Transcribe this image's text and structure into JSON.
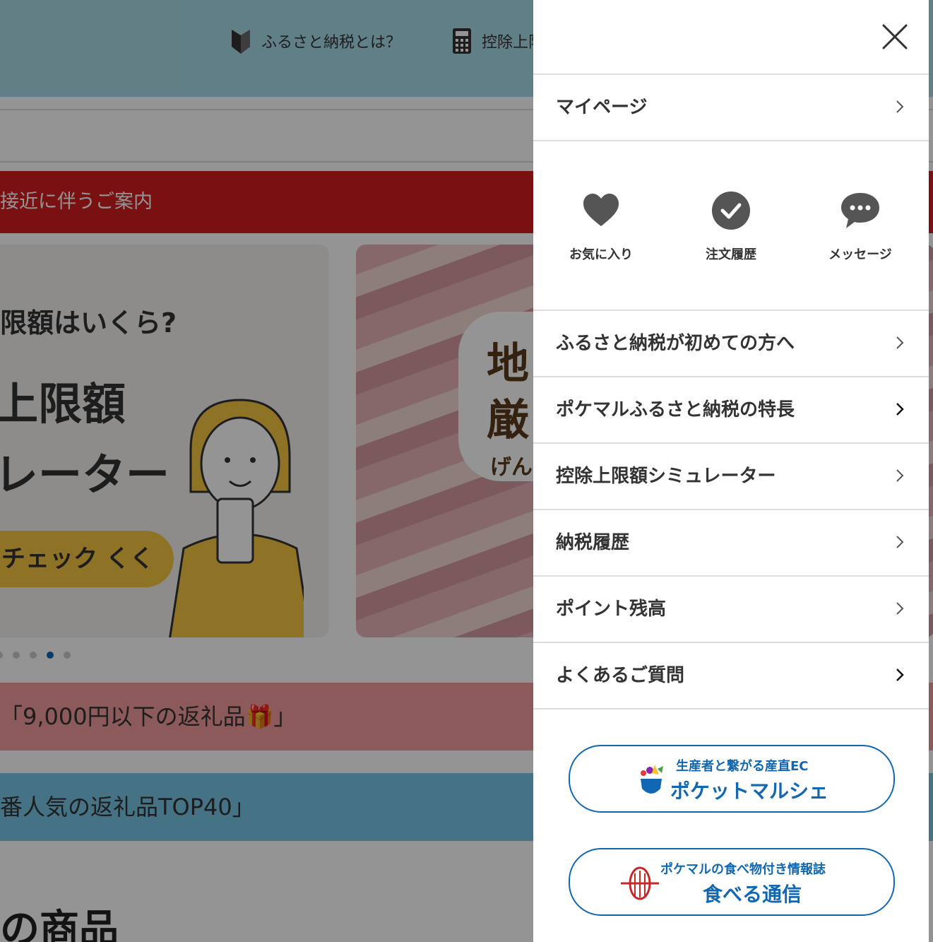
{
  "background": {
    "header_links": [
      {
        "label": "ふるさと納税とは？"
      },
      {
        "label": "控除上限額"
      }
    ],
    "notice_text": "接近に伴うご案内",
    "banner1": {
      "line1": "限額はいくら?",
      "line2": "上限額",
      "line3": "レーター",
      "cta": "チェック くく"
    },
    "banner2": {
      "line1": "地",
      "line2": "厳",
      "line3": "げん"
    },
    "carousel_active_index": 3,
    "pink_bar_text": "「9,000円以下の返礼品🎁」",
    "blue_bar_text": "番人気の返礼品TOP40」",
    "section_heading": "の商品"
  },
  "drawer": {
    "mypage_label": "マイページ",
    "shortcuts": [
      {
        "label": "お気に入り",
        "icon": "heart-icon"
      },
      {
        "label": "注文履歴",
        "icon": "check-circle-icon"
      },
      {
        "label": "メッセージ",
        "icon": "chat-bubble-icon"
      }
    ],
    "menu_items": [
      {
        "label": "ふるさと納税が初めての方へ"
      },
      {
        "label": "ポケマルふるさと納税の特長"
      },
      {
        "label": "控除上限額シミュレーター"
      },
      {
        "label": "納税履歴"
      },
      {
        "label": "ポイント残高"
      },
      {
        "label": "よくあるご質問"
      }
    ],
    "external_links": [
      {
        "line1": "生産者と繋がる産直EC",
        "line2": "ポケットマルシェ"
      },
      {
        "line1": "ポケマルの食べ物付き情報誌",
        "line2": "食べる通信"
      }
    ]
  },
  "colors": {
    "accent": "#1167b1",
    "icon_gray": "#555555",
    "overlay": "rgba(0,0,0,0.42)"
  }
}
